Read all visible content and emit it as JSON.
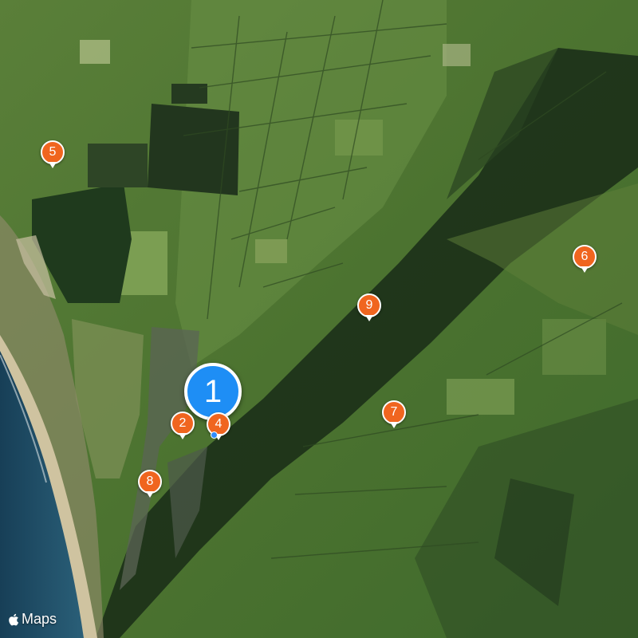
{
  "map": {
    "view": "satellite",
    "colors": {
      "pin": "#f0651f",
      "cluster": "#1e8ef5",
      "sea": "#1d4a63",
      "beach": "#cfc3a0"
    },
    "cluster": {
      "label": "1"
    },
    "pins": [
      {
        "label": "2"
      },
      {
        "label": "4"
      },
      {
        "label": "5"
      },
      {
        "label": "6"
      },
      {
        "label": "7"
      },
      {
        "label": "8"
      },
      {
        "label": "9"
      }
    ]
  },
  "attribution": {
    "text": "Maps",
    "icon": "apple-logo-icon"
  }
}
